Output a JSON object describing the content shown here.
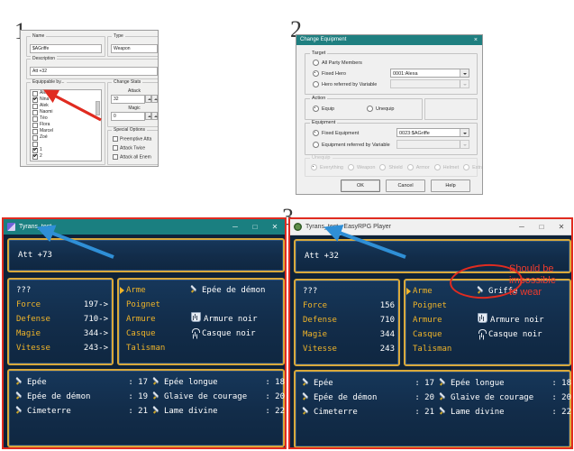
{
  "steps": {
    "one": "1",
    "two": "2",
    "three": "3"
  },
  "panel1": {
    "name_group": "Name",
    "name_value": "$AGriffe",
    "type_group": "Type",
    "type_value": "Weapon",
    "description_group": "Description",
    "description_value": "Att +32",
    "equippable_group": "Equippable by...",
    "equippable": [
      {
        "label": "Alexa",
        "checked": false
      },
      {
        "label": "Nina",
        "checked": true
      },
      {
        "label": "Alek",
        "checked": false
      },
      {
        "label": "Naomi",
        "checked": false
      },
      {
        "label": "Téo",
        "checked": false
      },
      {
        "label": "Flora",
        "checked": false
      },
      {
        "label": "Marcel",
        "checked": false
      },
      {
        "label": "Zoé",
        "checked": false
      },
      {
        "label": "",
        "checked": false
      },
      {
        "label": "1",
        "checked": true
      },
      {
        "label": "2",
        "checked": true
      }
    ],
    "change_stats_group": "Change Stats",
    "attack_label": "Attack",
    "attack_value": "32",
    "magic_label": "Magic",
    "magic_value": "0",
    "special_group": "Special Options",
    "special_options": [
      {
        "label": "Preemptive Atta",
        "checked": false
      },
      {
        "label": "Attack Twice",
        "checked": false
      },
      {
        "label": "Attack all Enem",
        "checked": false
      }
    ]
  },
  "panel2": {
    "title": "Change Equipment",
    "close_icon": "×",
    "target_group": "Target",
    "target_all": "All Party Members",
    "target_fixed": "Fixed Hero",
    "target_variable": "Hero referred by Variable",
    "hero_value": "0001:Alexa",
    "hero_variable_value": "",
    "action_group": "Action",
    "action_equip": "Equip",
    "action_unequip": "Unequip",
    "equipment_group": "Equipment",
    "equip_fixed": "Fixed Equipment",
    "equip_variable": "Equipment referred by Variable",
    "equipment_value": "0023:$AGriffe",
    "equipment_variable_value": "",
    "unequip_group": "Unequip",
    "unequip_options": [
      "Everything",
      "Weapon",
      "Shield",
      "Armor",
      "Helmet",
      "Extra"
    ],
    "ok_label": "OK",
    "cancel_label": "Cancel",
    "help_label": "Help"
  },
  "game_left": {
    "window_title": "Tyrans_test",
    "minimize_icon": "─",
    "maximize_icon": "□",
    "close_icon": "✕",
    "description": "Att +73",
    "hero_name": "???",
    "stats": [
      {
        "label": "Force",
        "value": "197->"
      },
      {
        "label": "Defense",
        "value": "710->"
      },
      {
        "label": "Magie",
        "value": "344->"
      },
      {
        "label": "Vitesse",
        "value": "243->"
      }
    ],
    "equipment": [
      {
        "slot": "Arme",
        "item": "Epée de démon",
        "icon": "sword-icon",
        "cursor": true
      },
      {
        "slot": "Poignet",
        "item": "",
        "icon": "",
        "cursor": false
      },
      {
        "slot": "Armure",
        "item": "Armure noir",
        "icon": "armor-icon",
        "cursor": false
      },
      {
        "slot": "Casque",
        "item": "Casque noir",
        "icon": "helmet-icon",
        "cursor": false
      },
      {
        "slot": "Talisman",
        "item": "",
        "icon": "",
        "cursor": false
      }
    ],
    "items": [
      {
        "name": "Epée",
        "num": ": 17"
      },
      {
        "name": "Epée longue",
        "num": ": 18"
      },
      {
        "name": "Epée de démon",
        "num": ": 19"
      },
      {
        "name": "Glaive de courage",
        "num": ": 20"
      },
      {
        "name": "Cimeterre",
        "num": ": 21"
      },
      {
        "name": "Lame divine",
        "num": ": 22"
      }
    ]
  },
  "game_right": {
    "window_title": "Tyrans_test - EasyRPG Player",
    "minimize_icon": "─",
    "maximize_icon": "□",
    "close_icon": "✕",
    "description": "Att +32",
    "hero_name": "???",
    "stats": [
      {
        "label": "Force",
        "value": "156"
      },
      {
        "label": "Defense",
        "value": "710"
      },
      {
        "label": "Magie",
        "value": "344"
      },
      {
        "label": "Vitesse",
        "value": "243"
      }
    ],
    "equipment": [
      {
        "slot": "Arme",
        "item": "Griffe",
        "icon": "sword-icon",
        "cursor": true
      },
      {
        "slot": "Poignet",
        "item": "",
        "icon": "",
        "cursor": false
      },
      {
        "slot": "Armure",
        "item": "Armure noir",
        "icon": "armor-icon",
        "cursor": false
      },
      {
        "slot": "Casque",
        "item": "Casque noir",
        "icon": "helmet-icon",
        "cursor": false
      },
      {
        "slot": "Talisman",
        "item": "",
        "icon": "",
        "cursor": false
      }
    ],
    "items": [
      {
        "name": "Epée",
        "num": ": 17"
      },
      {
        "name": "Epée longue",
        "num": ": 18"
      },
      {
        "name": "Epée de démon",
        "num": ": 20"
      },
      {
        "name": "Glaive de courage",
        "num": ": 20"
      },
      {
        "name": "Cimeterre",
        "num": ": 21"
      },
      {
        "name": "Lame divine",
        "num": ": 22"
      }
    ],
    "annotation": "Should be\nimpossible\nto wear"
  },
  "colors": {
    "annotation_red": "#ef3b2d",
    "arrow_blue": "#2f8fd6",
    "gold_border": "#d9a93b",
    "title_teal": "#1a7f80"
  }
}
